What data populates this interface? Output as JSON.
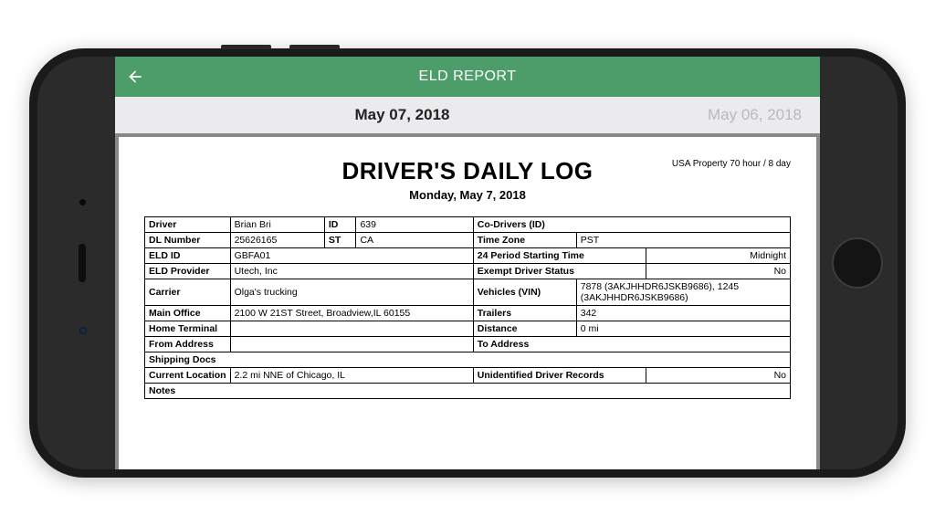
{
  "header": {
    "title": "ELD REPORT"
  },
  "tabs": {
    "active": "May 07, 2018",
    "inactive": "May 06, 2018"
  },
  "report": {
    "title": "DRIVER'S DAILY LOG",
    "date": "Monday, May 7, 2018",
    "ruleset": "USA Property 70 hour / 8 day",
    "left": {
      "driver": "Brian Bri",
      "id": "639",
      "dl_number": "25626165",
      "st": "CA",
      "eld_id": "GBFA01",
      "eld_provider": "Utech, Inc",
      "carrier": "Olga's trucking",
      "main_office": "2100 W 21ST Street, Broadview,IL 60155",
      "home_terminal": "",
      "from_address": "",
      "shipping_docs": "",
      "current_location": "2.2 mi NNE of Chicago, IL",
      "notes": ""
    },
    "right": {
      "co_drivers": "",
      "time_zone": "PST",
      "period_start": "Midnight",
      "exempt_status": "No",
      "vehicles": "7878 (3AKJHHDR6JSKB9686), 1245 (3AKJHHDR6JSKB9686)",
      "trailers": "342",
      "distance": "0 mi",
      "to_address": "",
      "unidentified": "No"
    },
    "labels": {
      "driver": "Driver",
      "id": "ID",
      "dl_number": "DL Number",
      "st": "ST",
      "eld_id": "ELD ID",
      "eld_provider": "ELD Provider",
      "carrier": "Carrier",
      "main_office": "Main Office",
      "home_terminal": "Home Terminal",
      "from_address": "From Address",
      "shipping_docs": "Shipping Docs",
      "current_location": "Current Location",
      "notes": "Notes",
      "co_drivers": "Co-Drivers (ID)",
      "time_zone": "Time Zone",
      "period_start": "24 Period Starting Time",
      "exempt_status": "Exempt Driver Status",
      "vehicles": "Vehicles (VIN)",
      "trailers": "Trailers",
      "distance": "Distance",
      "to_address": "To Address",
      "unidentified": "Unidentified Driver Records"
    }
  }
}
